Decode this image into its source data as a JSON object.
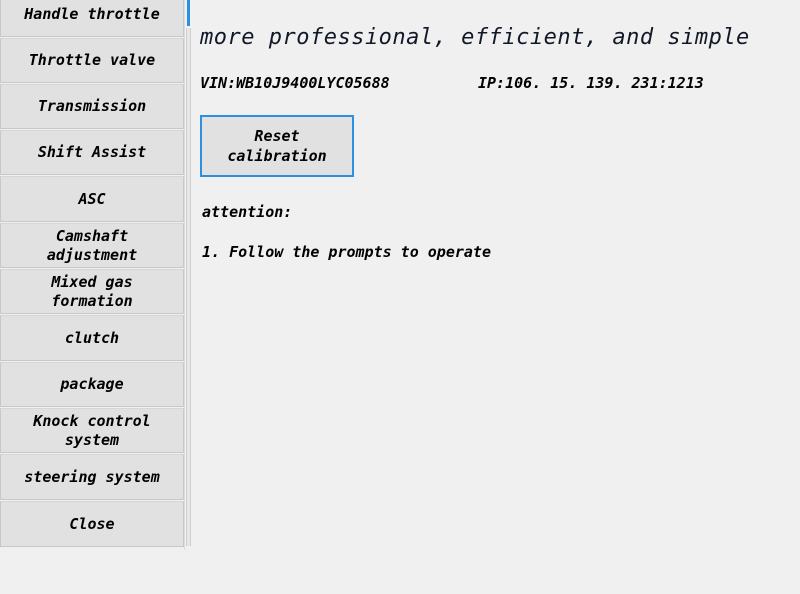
{
  "sidebar": {
    "items": [
      {
        "label": "Handle throttle"
      },
      {
        "label": "Throttle valve"
      },
      {
        "label": "Transmission"
      },
      {
        "label": "Shift Assist"
      },
      {
        "label": "ASC"
      },
      {
        "label": "Camshaft\nadjustment"
      },
      {
        "label": "Mixed gas\nformation"
      },
      {
        "label": "clutch"
      },
      {
        "label": "package"
      },
      {
        "label": "Knock control\nsystem"
      },
      {
        "label": "steering system"
      },
      {
        "label": "Close"
      }
    ]
  },
  "content": {
    "headline": "more professional, efficient, and simple",
    "vin": "VIN:WB10J9400LYC05688",
    "ip": "IP:106. 15. 139. 231:1213",
    "reset_button_label": "Reset\ncalibration",
    "attention_title": "attention:",
    "attention_items": [
      "1. Follow the prompts to operate"
    ]
  },
  "colors": {
    "accent_blue": "#2c8fe0",
    "page_background": "#f0f0f0",
    "button_face": "#e1e1e1",
    "button_border": "#c8c8c8",
    "text": "#000000"
  }
}
